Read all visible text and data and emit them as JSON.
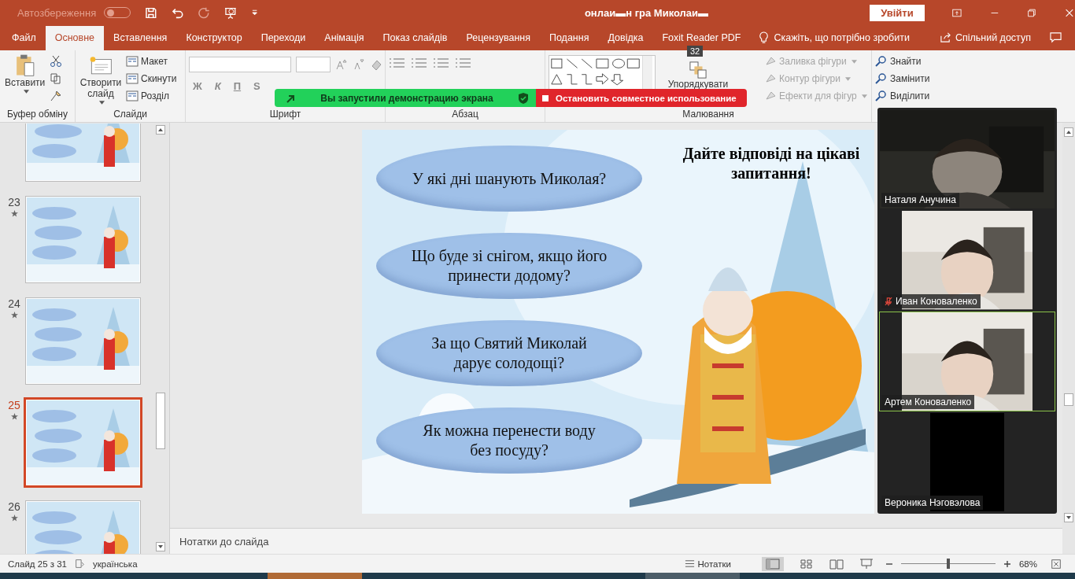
{
  "title_bar": {
    "autosave_label": "Автозбереження",
    "autosave_on": false,
    "title": "онлаи▬н гра Миколаи▬",
    "sign_in": "Увійти"
  },
  "tabs": [
    {
      "label": "Файл",
      "selected": false
    },
    {
      "label": "Основне",
      "selected": true
    },
    {
      "label": "Вставлення",
      "selected": false
    },
    {
      "label": "Конструктор",
      "selected": false
    },
    {
      "label": "Переходи",
      "selected": false
    },
    {
      "label": "Анімація",
      "selected": false
    },
    {
      "label": "Показ слайдів",
      "selected": false
    },
    {
      "label": "Рецензування",
      "selected": false
    },
    {
      "label": "Подання",
      "selected": false
    },
    {
      "label": "Довідка",
      "selected": false
    },
    {
      "label": "Foxit Reader PDF",
      "selected": false
    }
  ],
  "tell_me": "Скажіть, що потрібно зробити",
  "share": "Спільний доступ",
  "ribbon": {
    "clipboard": {
      "paste": "Вставити",
      "label": "Буфер обміну"
    },
    "slides": {
      "new_slide": "Створити слайд",
      "items": [
        "Макет",
        "Скинути",
        "Розділ"
      ],
      "label": "Слайди"
    },
    "font": {
      "styles": [
        "Ж",
        "К",
        "П",
        "S"
      ],
      "label": "Шрифт"
    },
    "paragraph": {
      "label": "Абзац"
    },
    "drawing": {
      "arrange": "Упорядкувати",
      "badge": "32",
      "items": [
        {
          "label": "Заливка фігури",
          "disabled": true
        },
        {
          "label": "Контур фігури",
          "disabled": true
        },
        {
          "label": "Ефекти для фігур",
          "disabled": true
        }
      ],
      "label": "Малювання"
    },
    "editing": [
      "Знайти",
      "Замінити",
      "Виділити"
    ]
  },
  "share_bar": {
    "message": "Вы запустили демонстрацию экрана",
    "stop": "Остановить совместное использование"
  },
  "thumbnails": [
    {
      "animated": false,
      "selected": false
    },
    {
      "number": "23",
      "animated": true,
      "selected": false
    },
    {
      "number": "24",
      "animated": true,
      "selected": false
    },
    {
      "number": "25",
      "animated": true,
      "selected": true
    },
    {
      "number": "26",
      "animated": true,
      "selected": false
    }
  ],
  "slide": {
    "title": "Дайте відповіді на цікаві запитання!",
    "questions": [
      "У які дні шанують Миколая?",
      "Що буде зі снігом, якщо його принести додому?",
      "За що Святий Миколай дарує солодощі?",
      "Як можна перенести воду без посуду?"
    ]
  },
  "notes_placeholder": "Нотатки до слайда",
  "participants": [
    {
      "name": "Наталя Анучина",
      "muted": false,
      "speaking": false,
      "video": true
    },
    {
      "name": "Иван Коноваленко",
      "muted": true,
      "speaking": false,
      "video": true
    },
    {
      "name": "Артем Коноваленко",
      "muted": false,
      "speaking": true,
      "video": true
    },
    {
      "name": "Вероника Нэговэлова",
      "muted": false,
      "speaking": false,
      "video": false
    }
  ],
  "status_bar": {
    "slide": "Слайд 25 з 31",
    "language": "українська",
    "notes": "Нотатки",
    "zoom": "68%",
    "level": 0.5
  }
}
